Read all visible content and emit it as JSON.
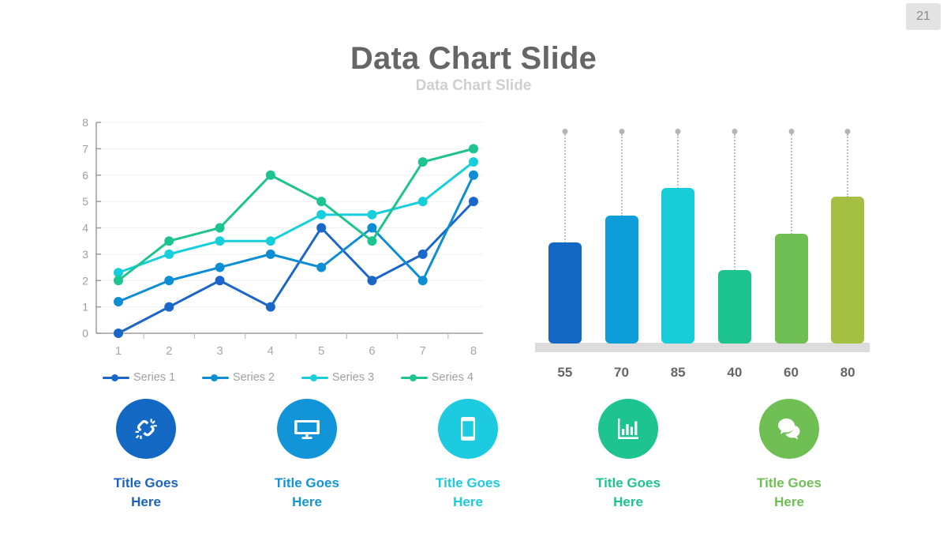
{
  "page": {
    "number": "21"
  },
  "header": {
    "title": "Data Chart Slide",
    "subtitle": "Data Chart Slide"
  },
  "line_legend": [
    {
      "label": "Series 1",
      "color": "#1b66c9"
    },
    {
      "label": "Series 2",
      "color": "#0d8ed4"
    },
    {
      "label": "Series 3",
      "color": "#17cfda"
    },
    {
      "label": "Series 4",
      "color": "#1ec48f"
    }
  ],
  "icons": [
    {
      "name": "broken-link-icon",
      "title_line1": "Title Goes",
      "title_line2": "Here",
      "circle_color": "#1368c4",
      "text_color": "#1b63c0"
    },
    {
      "name": "monitor-icon",
      "title_line1": "Title Goes",
      "title_line2": "Here",
      "circle_color": "#1295d8",
      "text_color": "#1295d8"
    },
    {
      "name": "mobile-phone-icon",
      "title_line1": "Title Goes",
      "title_line2": "Here",
      "circle_color": "#1ccbe0",
      "text_color": "#1ccbe0"
    },
    {
      "name": "bar-chart-icon",
      "title_line1": "Title Goes",
      "title_line2": "Here",
      "circle_color": "#1ec48f",
      "text_color": "#1ec48f"
    },
    {
      "name": "chat-bubbles-icon",
      "title_line1": "Title Goes",
      "title_line2": "Here",
      "circle_color": "#6fbf55",
      "text_color": "#6fbf55"
    }
  ],
  "chart_data": [
    {
      "type": "line",
      "title": "",
      "xlabel": "",
      "ylabel": "",
      "x": [
        1,
        2,
        3,
        4,
        5,
        6,
        7,
        8
      ],
      "xticklabels": [
        "1",
        "2",
        "3",
        "4",
        "5",
        "6",
        "7",
        "8"
      ],
      "yticklabels": [
        "0",
        "1",
        "2",
        "3",
        "4",
        "5",
        "6",
        "7",
        "8"
      ],
      "ylim": [
        0,
        8
      ],
      "grid": true,
      "legend_position": "bottom",
      "series": [
        {
          "name": "Series 1",
          "color": "#1b66c9",
          "values": [
            0,
            1,
            2,
            1,
            4,
            2,
            3,
            5
          ]
        },
        {
          "name": "Series 2",
          "color": "#0d8ed4",
          "values": [
            1.2,
            2,
            2.5,
            3,
            2.5,
            4,
            2,
            6
          ]
        },
        {
          "name": "Series 3",
          "color": "#17cfda",
          "values": [
            2.3,
            3,
            3.5,
            3.5,
            4.5,
            4.5,
            5,
            6.5
          ]
        },
        {
          "name": "Series 4",
          "color": "#1ec48f",
          "values": [
            2,
            3.5,
            4,
            6,
            5,
            3.5,
            6.5,
            7
          ]
        }
      ]
    },
    {
      "type": "bar",
      "title": "",
      "xlabel": "",
      "ylabel": "",
      "categories": [
        "55",
        "70",
        "85",
        "40",
        "60",
        "80"
      ],
      "values": [
        55,
        70,
        85,
        40,
        60,
        80
      ],
      "ylim": [
        0,
        100
      ],
      "grid": false,
      "colors": [
        "#1368c4",
        "#0d9dd9",
        "#16cdd8",
        "#1ec48f",
        "#6fbf55",
        "#a5bf42"
      ],
      "value_labels": [
        "55",
        "70",
        "85",
        "40",
        "60",
        "80"
      ]
    }
  ]
}
